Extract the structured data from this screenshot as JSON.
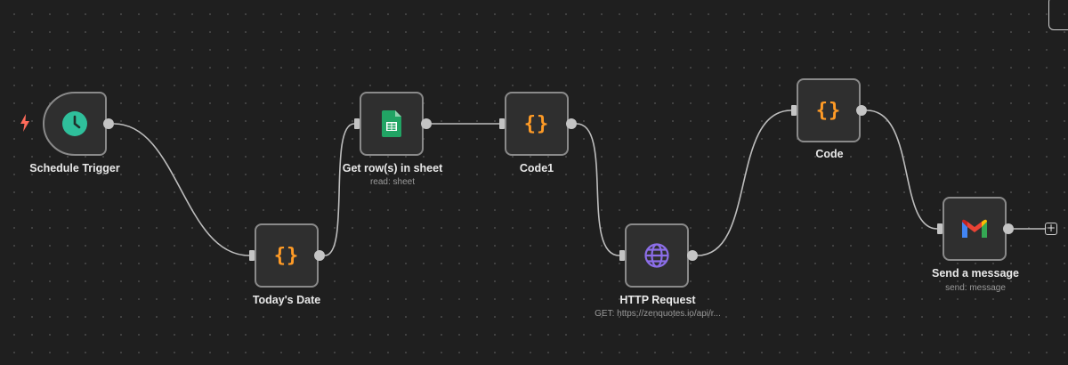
{
  "nodes": {
    "schedule_trigger": {
      "label": "Schedule Trigger",
      "icon": "clock-icon"
    },
    "todays_date": {
      "label": "Today's Date",
      "icon": "code-braces-icon",
      "glyph": "{}"
    },
    "get_rows": {
      "label": "Get row(s) in sheet",
      "subtitle": "read: sheet",
      "icon": "google-sheets-icon"
    },
    "code1": {
      "label": "Code1",
      "icon": "code-braces-icon",
      "glyph": "{}"
    },
    "http_request": {
      "label": "HTTP Request",
      "subtitle": "GET: https://zenquotes.io/api/r...",
      "icon": "globe-icon"
    },
    "code": {
      "label": "Code",
      "icon": "code-braces-icon",
      "glyph": "{}"
    },
    "send_message": {
      "label": "Send a message",
      "subtitle": "send: message",
      "icon": "gmail-icon"
    }
  },
  "add_node": {
    "symbol": "+"
  },
  "colors": {
    "canvas": "#1f1f1f",
    "node_bg": "#2f2f2f",
    "node_border": "#8a8a8a",
    "edge": "#bdbdbd",
    "code_accent": "#ff9b26",
    "clock": "#2fbf9b",
    "sheets": "#21a464",
    "globe": "#8c6ee8",
    "trigger_bolt": "#ff6b5b"
  }
}
